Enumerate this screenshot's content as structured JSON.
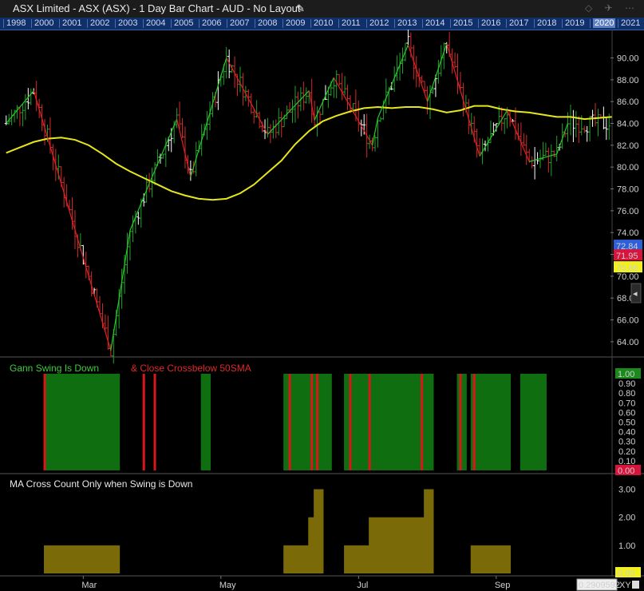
{
  "window": {
    "title": "ASX Limited - ASX (ASX) - 1 Day Bar Chart - AUD - No Layout",
    "edit_icon": "pencil-icon",
    "window_icons": "◇ ✈ ⋯"
  },
  "year_bar": {
    "years": [
      "1998",
      "2000",
      "2001",
      "2002",
      "2003",
      "2004",
      "2005",
      "2006",
      "2007",
      "2008",
      "2009",
      "2010",
      "2011",
      "2012",
      "2013",
      "2014",
      "2015",
      "2016",
      "2017",
      "2018",
      "2019",
      "2020",
      "2021"
    ],
    "selected": "2020"
  },
  "colors": {
    "up_bar": "#1fa32a",
    "down_bar": "#d42a2a",
    "neutral_bar": "#ffffff",
    "sma": "#e6e61a",
    "swing_down": "#e02020",
    "swing_up": "#28c828",
    "panel2_fill": "#0f6e0f",
    "panel2_event": "#d81818",
    "panel3_fill": "#7a6a08",
    "badge_blue": "#2e5fd8",
    "badge_red": "#d8143c",
    "badge_yellow": "#f2f21a",
    "badge_green": "#1a8a1a"
  },
  "chart_data": [
    {
      "type": "ohlc_bar",
      "panel": "price",
      "x_tick_labels": [
        "Mar",
        "May",
        "Jul",
        "Sep"
      ],
      "ylim": [
        62.6,
        92.6
      ],
      "y_ticks": [
        64.0,
        66.0,
        68.0,
        70.0,
        72.0,
        74.0,
        76.0,
        78.0,
        80.0,
        82.0,
        84.0,
        86.0,
        88.0,
        90.0
      ],
      "y_tick_labels": [
        "64.00",
        "66.00",
        "68.0",
        "70.00",
        "72.00",
        "74.00",
        "76.00",
        "78.00",
        "80.00",
        "82.00",
        "84.00",
        "86.00",
        "88.00",
        "90.00"
      ],
      "series": [
        {
          "name": "",
          "kind": "sma_line",
          "x": [
            0,
            5,
            10,
            15,
            20,
            25,
            30,
            35,
            40,
            45,
            50,
            55,
            60,
            65,
            70,
            75,
            80,
            85,
            90,
            95,
            100,
            105,
            110,
            115,
            120,
            125,
            130,
            135,
            140,
            145,
            150,
            155,
            160,
            165,
            170,
            175,
            180,
            185,
            190,
            195,
            200,
            205,
            210,
            215,
            220
          ],
          "y": [
            81.3,
            81.8,
            82.3,
            82.6,
            82.7,
            82.5,
            82.0,
            81.2,
            80.3,
            79.6,
            79.0,
            78.4,
            77.8,
            77.4,
            77.1,
            77.0,
            77.1,
            77.6,
            78.4,
            79.5,
            80.6,
            82.1,
            83.3,
            84.2,
            84.7,
            85.1,
            85.4,
            85.5,
            85.4,
            85.5,
            85.5,
            85.3,
            85.0,
            85.2,
            85.6,
            85.6,
            85.3,
            85.1,
            85.0,
            84.8,
            84.6,
            84.6,
            84.4,
            84.5,
            84.6
          ]
        },
        {
          "name": "",
          "kind": "gann_swing",
          "x": [
            0,
            10,
            38,
            45,
            52,
            62,
            67,
            80,
            95,
            110,
            112,
            119,
            133,
            135,
            146,
            153,
            160,
            172,
            182,
            190,
            200,
            204
          ],
          "y": [
            84.0,
            87.0,
            63.2,
            74.2,
            78.5,
            84.4,
            79.1,
            90.0,
            83.0,
            87.0,
            84.3,
            88.2,
            82.0,
            84.5,
            91.2,
            86.0,
            91.3,
            81.0,
            85.2,
            80.5,
            81.2,
            84.0
          ]
        }
      ],
      "price_badges": [
        {
          "label": "72.84",
          "value": 72.84,
          "color": "#2e5fd8",
          "text_color": "#ffffff"
        },
        {
          "label": "71.95",
          "value": 71.95,
          "color": "#d8143c",
          "text_color": "#ffffff"
        },
        {
          "label": "70.86",
          "value": 70.86,
          "color": "#f2f21a",
          "text_color": "#000000"
        }
      ]
    },
    {
      "type": "step",
      "panel": "condition",
      "title_parts": [
        "Gann Swing Is Down",
        "& Close Crossbelow 50SMA"
      ],
      "ylim": [
        0,
        1
      ],
      "y_ticks": [
        0.1,
        0.2,
        0.3,
        0.4,
        0.5,
        0.6,
        0.7,
        0.8,
        0.9
      ],
      "y_tick_labels": [
        "0.10",
        "0.20",
        "0.30",
        "0.40",
        "0.50",
        "0.60",
        "0.70",
        "0.80",
        "0.90"
      ],
      "badges": [
        {
          "label": "1.00",
          "value": 1.0,
          "color": "#1a8a1a",
          "text_color": "#ffffff"
        },
        {
          "label": "0.00",
          "value": 0.0,
          "color": "#d8143c",
          "text_color": "#ffffff"
        }
      ],
      "fill_ranges": [
        [
          14,
          41
        ],
        [
          71,
          74
        ],
        [
          101,
          118
        ],
        [
          123,
          155
        ],
        [
          164,
          167
        ],
        [
          169,
          183
        ],
        [
          187,
          196
        ]
      ],
      "events": [
        14,
        50,
        54,
        103,
        111,
        113,
        125,
        132,
        151,
        165,
        170
      ]
    },
    {
      "type": "step_area",
      "panel": "count",
      "title": "MA Cross Count Only when Swing is Down",
      "ylim": [
        0,
        3.3
      ],
      "y_ticks": [
        1,
        2,
        3
      ],
      "y_tick_labels": [
        "1.00",
        "2.00",
        "3.00"
      ],
      "badges": [
        {
          "label": "0.00",
          "value": 0.0,
          "color": "#f2f21a",
          "text_color": "#000000"
        }
      ],
      "segments": [
        [
          14,
          41,
          1
        ],
        [
          101,
          110,
          1
        ],
        [
          110,
          112,
          2
        ],
        [
          112,
          115,
          3
        ],
        [
          123,
          132,
          1
        ],
        [
          132,
          152,
          2
        ],
        [
          152,
          155,
          3
        ],
        [
          169,
          183,
          1
        ]
      ]
    }
  ],
  "time_field": "0.2909592"
}
